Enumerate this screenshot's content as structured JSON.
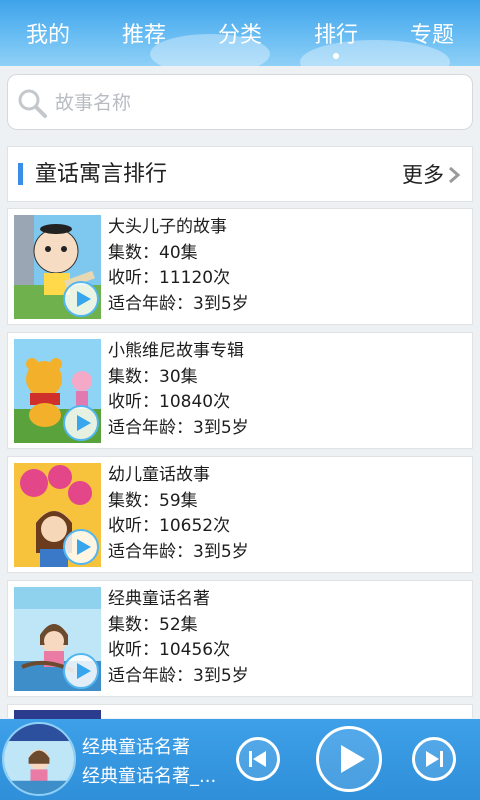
{
  "nav": {
    "tabs": [
      {
        "label": "我的",
        "active": false
      },
      {
        "label": "推荐",
        "active": false
      },
      {
        "label": "分类",
        "active": false
      },
      {
        "label": "排行",
        "active": true
      },
      {
        "label": "专题",
        "active": false
      }
    ]
  },
  "search": {
    "placeholder": "故事名称"
  },
  "section": {
    "title": "童话寓言排行",
    "more_label": "更多"
  },
  "stories": [
    {
      "title": "大头儿子的故事",
      "episodes": "集数：40集",
      "plays": "收听：11120次",
      "age": "适合年龄：3到5岁"
    },
    {
      "title": "小熊维尼故事专辑",
      "episodes": "集数：30集",
      "plays": "收听：10840次",
      "age": "适合年龄：3到5岁"
    },
    {
      "title": "幼儿童话故事",
      "episodes": "集数：59集",
      "plays": "收听：10652次",
      "age": "适合年龄：3到5岁"
    },
    {
      "title": "经典童话名著",
      "episodes": "集数：52集",
      "plays": "收听：10456次",
      "age": "适合年龄：3到5岁"
    }
  ],
  "player": {
    "title": "经典童话名著",
    "subtitle": "经典童话名著_..."
  },
  "colors": {
    "accent": "#3a8ee6",
    "nav_bg": "#4aa9ee",
    "play": "#37a6ec"
  }
}
